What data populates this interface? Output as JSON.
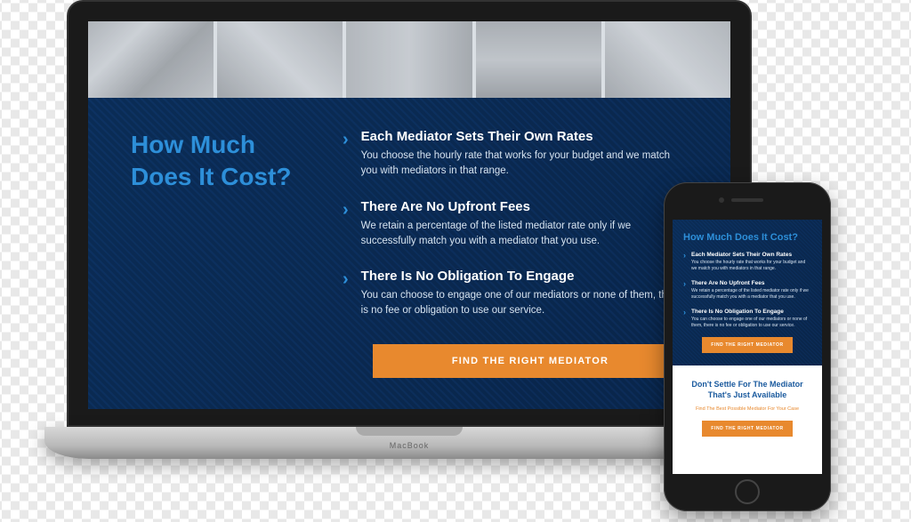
{
  "laptop": {
    "brand": "MacBook",
    "heading": "How Much Does It Cost?",
    "items": [
      {
        "title": "Each Mediator Sets Their Own Rates",
        "desc": "You choose the hourly rate that works for your budget and we match you with mediators in that range."
      },
      {
        "title": "There Are No Upfront Fees",
        "desc": "We retain a percentage of the listed mediator rate only if we successfully match you with a mediator that you use."
      },
      {
        "title": "There Is No Obligation To Engage",
        "desc": "You can choose to engage one of our mediators or none of them, there is no fee or obligation to use our service."
      }
    ],
    "cta": "FIND THE RIGHT MEDIATOR"
  },
  "phone": {
    "heading": "How Much Does It Cost?",
    "items": [
      {
        "title": "Each Mediator Sets Their Own Rates",
        "desc": "You choose the hourly rate that works for your budget and we match you with mediators in that range."
      },
      {
        "title": "There Are No Upfront Fees",
        "desc": "We retain a percentage of the listed mediator rate only if we successfully match you with a mediator that you use."
      },
      {
        "title": "There Is No Obligation To Engage",
        "desc": "You can choose to engage one of our mediators or none of them, there is no fee or obligation to use our service."
      }
    ],
    "cta": "FIND THE RIGHT MEDIATOR",
    "settle": {
      "heading": "Don't Settle For The Mediator That's Just Available",
      "sub": "Find The Best Possible Mediator For Your Case",
      "cta": "FIND THE RIGHT MEDIATOR"
    }
  }
}
